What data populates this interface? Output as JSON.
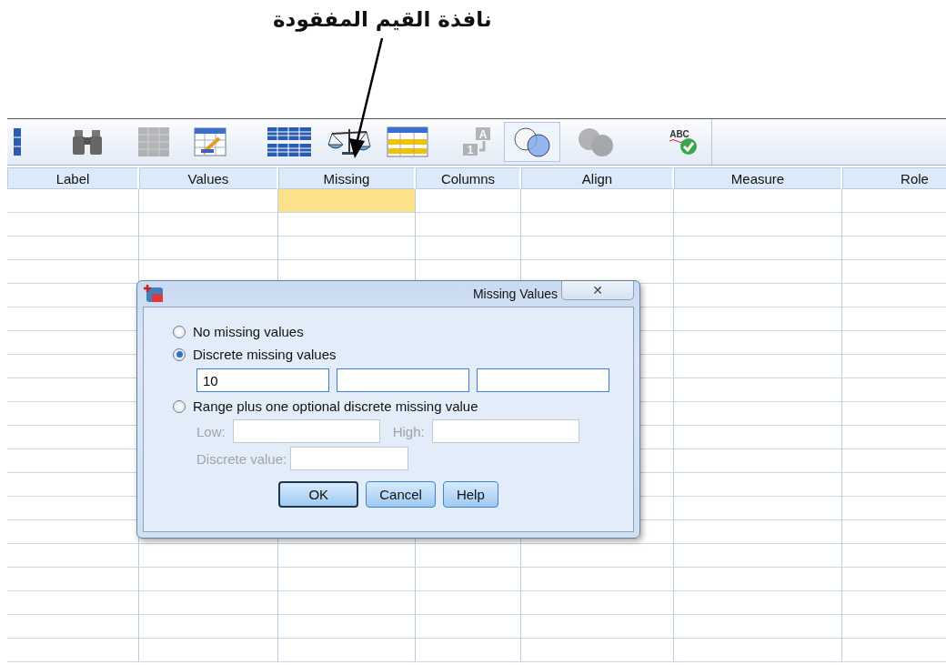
{
  "annotation": {
    "caption": "نافذة القيم المفقودة"
  },
  "toolbar": [
    {
      "kind": "grid-edge",
      "disabled": false,
      "pressed": false
    },
    {
      "kind": "binoculars",
      "disabled": false,
      "pressed": false
    },
    {
      "kind": "grid-chart",
      "disabled": true,
      "pressed": false
    },
    {
      "kind": "ruler-table",
      "disabled": false,
      "pressed": false
    },
    {
      "kind": "split-table",
      "disabled": false,
      "pressed": false
    },
    {
      "kind": "scales",
      "disabled": false,
      "pressed": false
    },
    {
      "kind": "yellow-table",
      "disabled": false,
      "pressed": false
    },
    {
      "kind": "sort",
      "disabled": true,
      "pressed": false,
      "glyphs": [
        "A",
        "1"
      ]
    },
    {
      "kind": "circles",
      "disabled": false,
      "pressed": true
    },
    {
      "kind": "circles",
      "disabled": true,
      "pressed": false
    },
    {
      "kind": "spellcheck",
      "disabled": false,
      "pressed": false,
      "glyphs": [
        "ABC"
      ]
    }
  ],
  "grid": {
    "columns": [
      {
        "label": "Label",
        "selected": false
      },
      {
        "label": "Values",
        "selected": false
      },
      {
        "label": "Missing",
        "selected": true
      },
      {
        "label": "Columns",
        "selected": false
      },
      {
        "label": "Align",
        "selected": false
      },
      {
        "label": "Measure",
        "selected": false
      },
      {
        "label": "Role",
        "selected": false
      }
    ]
  },
  "dialog": {
    "title": "Missing Values",
    "options": [
      {
        "label": "No missing values",
        "selected": false
      },
      {
        "label": "Discrete missing values",
        "selected": true
      },
      {
        "label": "Range plus one optional discrete missing value",
        "selected": false
      }
    ],
    "close_button": {
      "glyph": "✕"
    },
    "discrete_values": [
      "10"
    ],
    "range_fields": [
      {
        "label": "Low:",
        "disabled": true
      },
      {
        "label": "High:",
        "disabled": true
      }
    ],
    "discrete_value_field": {
      "label": "Discrete value:",
      "disabled": true
    },
    "buttons": [
      {
        "label": "OK",
        "default": true
      },
      {
        "label": "Cancel",
        "default": false
      },
      {
        "label": "Help",
        "default": false
      }
    ]
  }
}
